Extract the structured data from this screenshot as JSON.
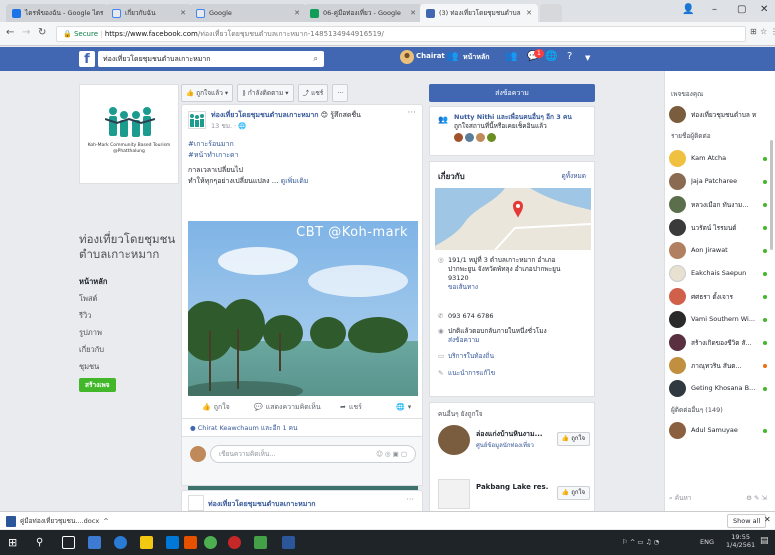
{
  "browser": {
    "tabs": [
      {
        "title": "ไดรฟ์ของฉัน - Google ไดร",
        "color": "#1a73e8",
        "active": false
      },
      {
        "title": "เกี่ยวกับฉัน",
        "color": "#e8eaed",
        "active": false
      },
      {
        "title": "Google",
        "color": "#e8eaed",
        "active": false
      },
      {
        "title": "06-คู่มือท่องเที่ยว - Google",
        "color": "#0f9d58",
        "active": false
      },
      {
        "title": "(3) ท่องเที่ยวโดยชุมชนตำบล",
        "color": "#4267b2",
        "active": true
      }
    ],
    "window": {
      "minimize": "–",
      "maximize": "▢",
      "close": "✕",
      "profile": "👤"
    },
    "address": {
      "secure_label": "Secure",
      "host": "https://www.facebook.com",
      "path": "/ท่องเที่ยวโดยชุมชนตำบลเกาะหมาก-1485134944916519/"
    }
  },
  "fb": {
    "logo": "f",
    "search_value": "ท่องเที่ยวโดยชุมชนตำบลเกาะหมาก",
    "user_name": "Chairat",
    "home_label": "หน้าหลัก",
    "friend_badge": "",
    "notif_badge": "1"
  },
  "page": {
    "logo_caption": "Koh-Mark Community Based Tourism @Phatthalung",
    "name": "ท่องเที่ยวโดยชุมชนตำบลเกาะหมาก",
    "nav": [
      "หน้าหลัก",
      "โพสต์",
      "รีวิว",
      "รูปภาพ",
      "เกี่ยวกับ",
      "ชุมชน"
    ],
    "create_button": "สร้างเพจ"
  },
  "actions": {
    "liked": "ถูกใจแล้ว ▾",
    "following": "กำลังติดตาม ▾",
    "share": "แชร์",
    "more": "···"
  },
  "post": {
    "author": "ท่องเที่ยวโดยชุมชนตำบลเกาะหมาก",
    "feeling": "รู้สึกสดชื่น",
    "time": "13 ชม. · 🌐",
    "hashtags": [
      "#เกาะร้อนมาก",
      "#หน้าทำเกาะดา"
    ],
    "text_line1": "กาลเวลาเปลี่ยนไป",
    "text_line2": "ทำให้ทุกๆอย่างเปลี่ยนแปลง ...",
    "see_more": "ดูเพิ่มเติม",
    "photo_watermark": "CBT @Koh-mark",
    "like_label": "ถูกใจ",
    "comment_label": "แสดงความคิดเห็น",
    "share_label": "แชร์",
    "likers": "Chirat Keawchaum และอีก 1 คน",
    "comment_placeholder": "เขียนความคิดเห็น..."
  },
  "post2": {
    "title": "ท่องเที่ยวโดยชุมชนตำบลเกาะหมาก"
  },
  "right": {
    "send_message": "ส่งข้อความ",
    "friend_line1": "Nutty Nithi และเพื่อนคนอื่นๆ อีก 3 คน",
    "friend_line2": "ถูกใจสถานที่นี้หรือเคยเช็คอินแล้ว",
    "about_heading": "เกี่ยวกับ",
    "about_all": "ดูทั้งหมด",
    "address_text": "191/1 หมู่ที่ 3 ตำบลเกาะหมาก อำเภอปากพะยูน จังหวัดพัทลุง อำเภอปากพะยูน 93120",
    "directions": "ขอเส้นทาง",
    "phone": "093 674 6786",
    "response": "ปกติแล้วตอบกลับภายในหนึ่งชั่วโมง",
    "response_link": "ส่งข้อความ",
    "service": "บริการในท้องถิ่น",
    "suggest": "แนะนำการแก้ไข",
    "people_heading": "คนอื่นๆ ยังถูกใจ",
    "people": [
      {
        "title": "ล่องแก่งบ้านหินงาม...",
        "sub": "ศูนย์ข้อมูลนักท่องเที่ยว",
        "like": "ถูกใจ"
      },
      {
        "title": "Pakbang Lake res...",
        "sub": "",
        "like": "ถูกใจ"
      }
    ]
  },
  "chat": {
    "header": "เพจของคุณ",
    "page_item": "ท่องเที่ยวชุมชนตำบล หาด...",
    "contacts_header": "รายชื่อผู้ติดต่อ",
    "contacts": [
      "Kam Atcha",
      "Jaja Patcharee",
      "หลวงเมือก ทันงาม...",
      "นวรัตน์ ไรรมนต์",
      "Aon Jirawat",
      "Eakchais Saepun",
      "ศศธรา ตั้งเจาร",
      "Vami Southern Wi...",
      "สร้างเกิดของชีวิต สั...",
      "ภาณุทวริน สันต...",
      "Geting Khosana B..."
    ],
    "groups_header": "ผู้ติดต่ออื่นๆ (149)",
    "more_contact": "Adul Samuyae",
    "search_placeholder": "ค้นหา"
  },
  "download": {
    "file": "คู่มือท่องเที่ยวชุมชน....docx",
    "caret": "^",
    "show_all": "Show all",
    "close": "✕"
  },
  "taskbar": {
    "lang": "ENG",
    "time": "19:55",
    "date": "1/4/2561"
  }
}
